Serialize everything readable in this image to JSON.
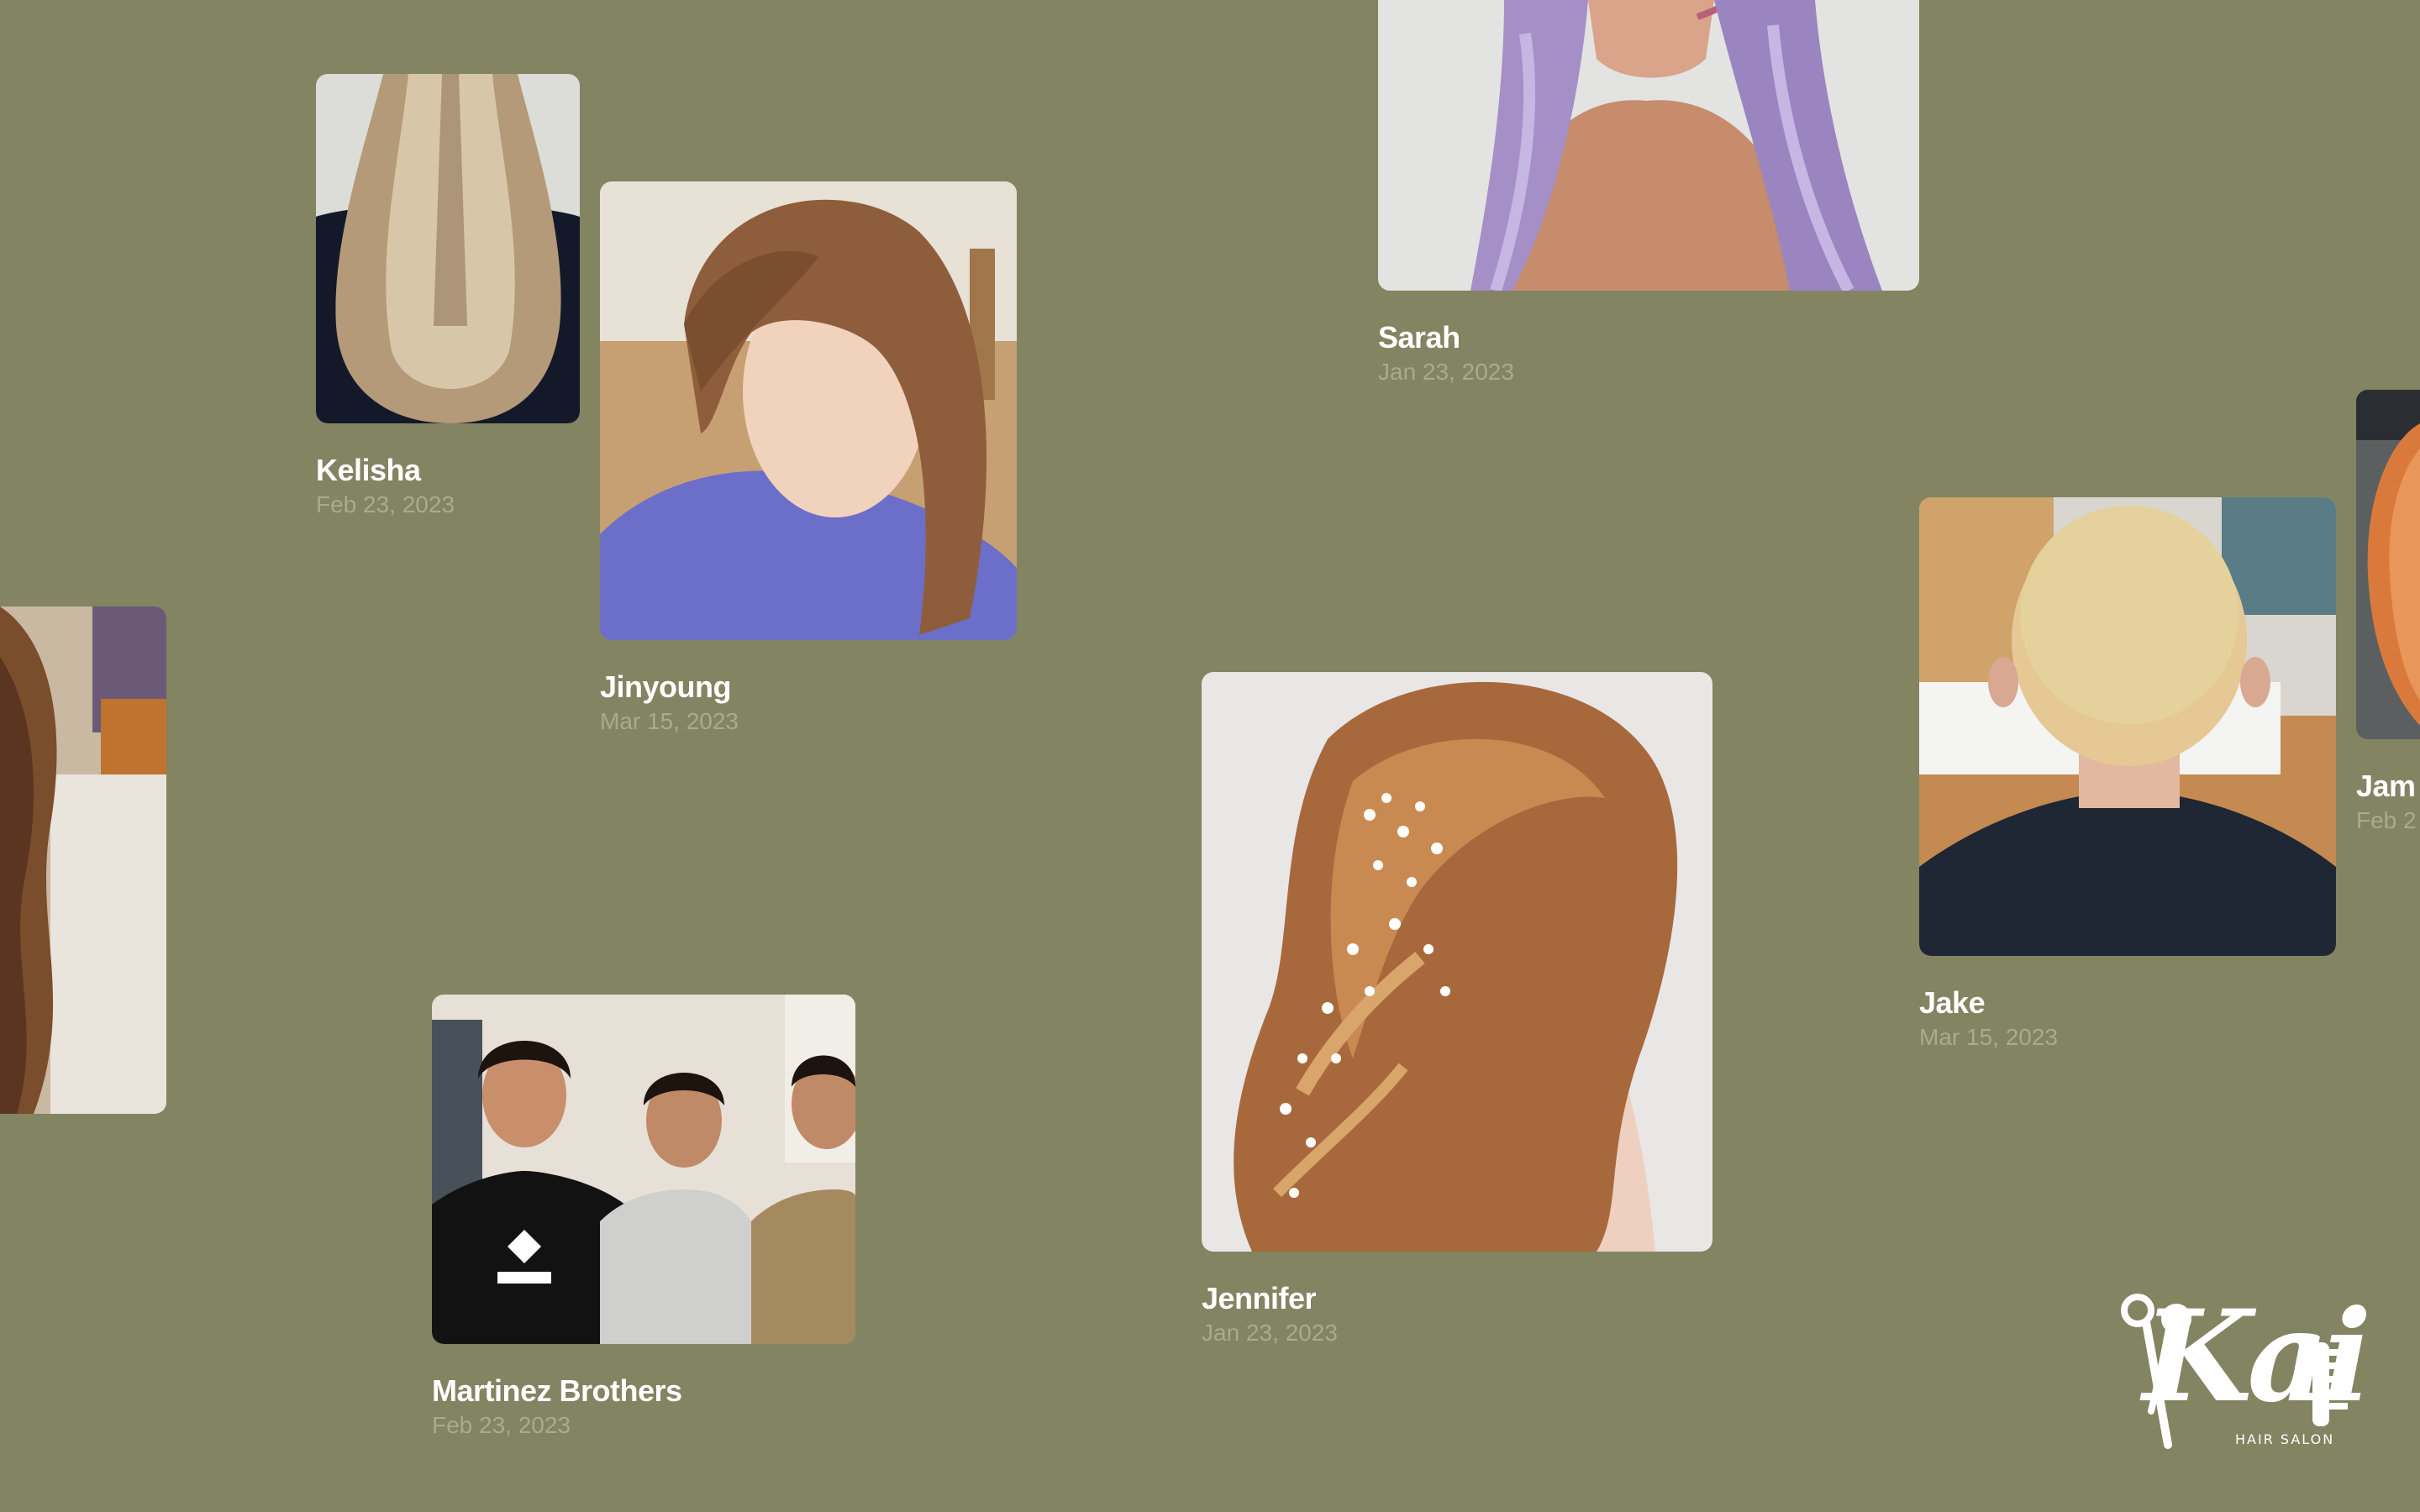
{
  "gallery": {
    "cards": [
      {
        "id": "kelisha",
        "name": "Kelisha",
        "date": "Feb 23, 2023"
      },
      {
        "id": "jinyoung",
        "name": "Jinyoung",
        "date": "Mar 15, 2023"
      },
      {
        "id": "sarah",
        "name": "Sarah",
        "date": "Jan 23, 2023"
      },
      {
        "id": "jake",
        "name": "Jake",
        "date": "Mar 15, 2023"
      },
      {
        "id": "jennifer",
        "name": "Jennifer",
        "date": "Jan 23, 2023"
      },
      {
        "id": "martinez",
        "name": "Martinez Brothers",
        "date": "Feb 23, 2023"
      },
      {
        "id": "jam",
        "name": "Jam",
        "date": "Feb 2"
      }
    ]
  },
  "brand": {
    "logo_text": "Kai",
    "tagline": "HAIR SALON"
  },
  "colors": {
    "background": "#828462",
    "name_text": "#ffffff",
    "date_text": "#a9ab8d"
  }
}
